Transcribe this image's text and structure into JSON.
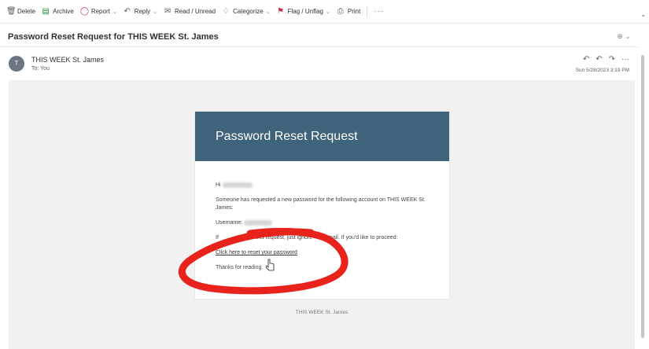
{
  "toolbar": {
    "delete": "Delete",
    "archive": "Archive",
    "report": "Report",
    "reply": "Reply",
    "read_unread": "Read / Unread",
    "categorize": "Categorize",
    "flag": "Flag / Unflag",
    "print": "Print",
    "more": "···"
  },
  "subject": "Password Reset Request for THIS WEEK St. James",
  "sender": {
    "initial": "T",
    "name": "THIS WEEK St. James",
    "to": "To: You",
    "date": "Sun 5/28/2023 3:19 PM"
  },
  "email": {
    "title": "Password Reset Request",
    "greeting": "Hi",
    "para1": "Someone has requested a new password for the following account on THIS WEEK St. James:",
    "username_label": "Username:",
    "para2_start": "If",
    "para2_mid": "t make this request, just ignore",
    "para2_end": "mail. If you'd like to proceed:",
    "reset_link": "Click here to reset your password",
    "thanks": "Thanks for reading.",
    "footer": "THIS WEEK St. James"
  },
  "colors": {
    "header_bg": "#3f637a",
    "annotation": "#e8231b"
  }
}
